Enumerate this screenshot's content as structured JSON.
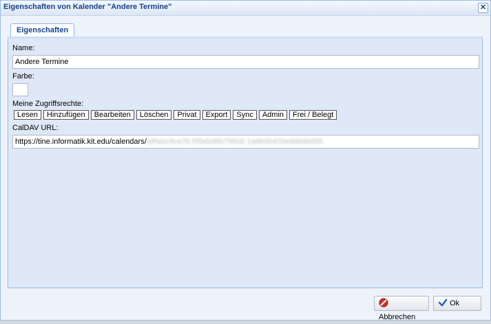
{
  "window": {
    "title": "Eigenschaften von Kalender \"Andere Termine\"",
    "close_icon": "✕"
  },
  "tabs": [
    {
      "label": "Eigenschaften",
      "active": true
    }
  ],
  "form": {
    "name_label": "Name:",
    "name_value": "Andere Termine",
    "color_label": "Farbe:",
    "color_value": "#ffffff",
    "rights_label": "Meine Zugriffsrechte:",
    "rights": [
      "Lesen",
      "Hinzufügen",
      "Bearbeiten",
      "Löschen",
      "Privat",
      "Export",
      "Sync",
      "Admin",
      "Frei / Belegt"
    ],
    "caldav_label": "CalDAV URL:",
    "caldav_url_prefix": "https://tine.informatik.kit.edu/calendars/",
    "caldav_url_suffix": "a8fa0c9ca7b f35ebd8b79606 1a8649400e6bbd9d95"
  },
  "footer": {
    "cancel_label": "Abbrechen",
    "ok_label": "Ok"
  },
  "colors": {
    "accent": "#15428b",
    "panel_bg": "#dfe8f6",
    "border": "#99bbe8"
  }
}
